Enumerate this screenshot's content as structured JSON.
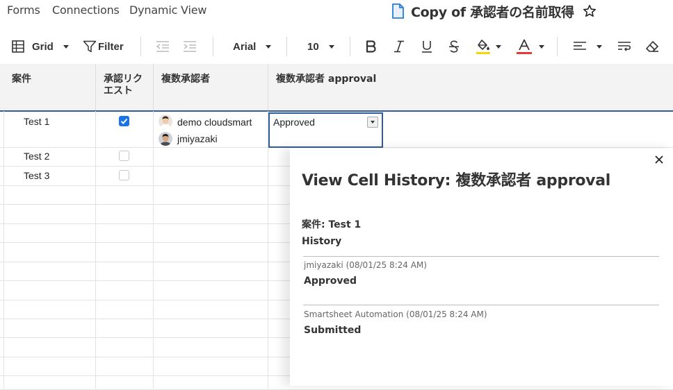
{
  "nav": {
    "items": [
      "Forms",
      "Connections",
      "Dynamic View"
    ]
  },
  "sheet": {
    "title": "Copy of 承認者の名前取得"
  },
  "toolbar": {
    "view_label": "Grid",
    "filter_label": "Filter",
    "font_family": "Arial",
    "font_size": "10"
  },
  "grid": {
    "columns": [
      "案件",
      "承認リクエスト",
      "複数承認者",
      "複数承認者 approval"
    ],
    "rows": [
      {
        "name": "Test 1",
        "checked": true,
        "approvers": [
          "demo cloudsmart",
          "jmiyazaki"
        ],
        "approval": "Approved"
      },
      {
        "name": "Test 2",
        "checked": false,
        "approvers": [],
        "approval": ""
      },
      {
        "name": "Test 3",
        "checked": false,
        "approvers": [],
        "approval": ""
      }
    ]
  },
  "panel": {
    "title": "View Cell History: 複数承認者 approval",
    "row_label": "案件: Test 1",
    "history_label": "History",
    "entries": [
      {
        "meta": "jmiyazaki (08/01/25 8:24 AM)",
        "value": "Approved"
      },
      {
        "meta": "Smartsheet Automation (08/01/25 8:24 AM)",
        "value": "Submitted"
      }
    ],
    "close_icon": "close-icon"
  },
  "colors": {
    "accent": "#2f5a9e",
    "checkbox": "#1a73e8",
    "header_bg": "#f3f3f3",
    "fill_underline": "#f5d800",
    "text_color_underline": "#e53935"
  }
}
